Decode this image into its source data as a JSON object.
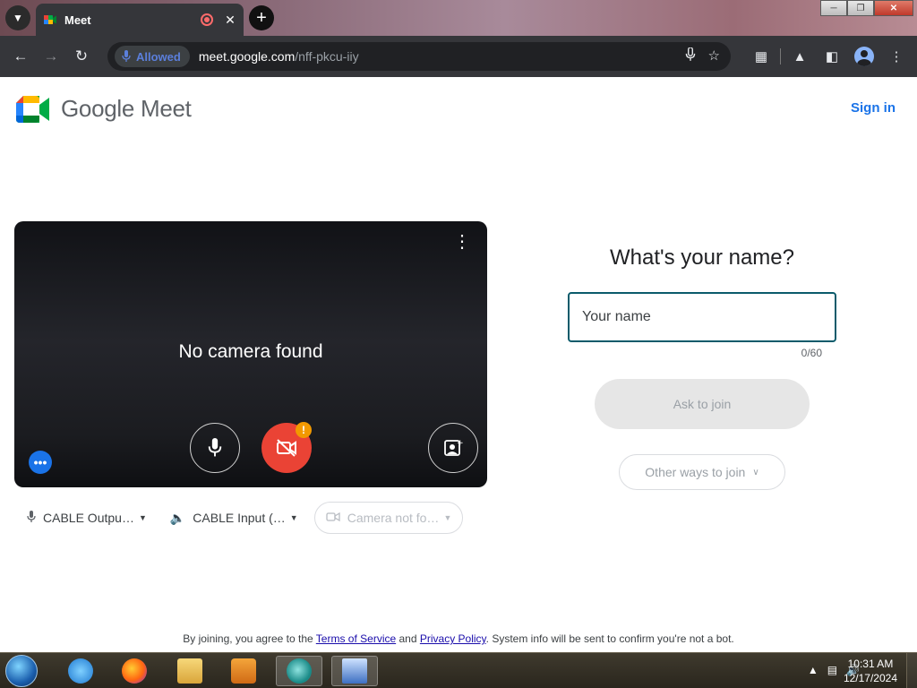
{
  "browser": {
    "tab_title": "Meet",
    "tab_close": "✕",
    "new_tab": "+",
    "permission_chip": "Allowed",
    "url_domain": "meet.google.com",
    "url_path": "/nff-pkcu-iiy"
  },
  "header": {
    "logo_text": "Google Meet",
    "sign_in": "Sign in"
  },
  "preview": {
    "message": "No camera found",
    "warning_badge": "!",
    "more_options": "•••"
  },
  "devices": {
    "microphone": "CABLE Outpu…",
    "speaker": "CABLE Input (…",
    "camera": "Camera not fo…"
  },
  "join": {
    "title": "What's your name?",
    "name_placeholder": "Your name",
    "name_value": "",
    "counter": "0/60",
    "ask_to_join": "Ask to join",
    "other_ways": "Other ways to join"
  },
  "footer": {
    "prefix": "By joining, you agree to the ",
    "terms": "Terms of Service",
    "and": " and ",
    "privacy": "Privacy Policy",
    "suffix": ". System info will be sent to confirm you're not a bot."
  },
  "taskbar": {
    "time": "10:31 AM",
    "date": "12/17/2024"
  },
  "colors": {
    "brand_blue": "#1a73e8",
    "camera_off_red": "#ea4335",
    "input_border": "#0b5b6b",
    "warning": "#f29900"
  }
}
